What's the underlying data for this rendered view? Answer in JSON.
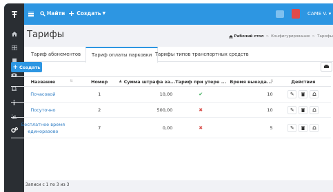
{
  "topbar": {
    "search_label": "Найти",
    "create_label": "Создать",
    "user_label": "CAME V."
  },
  "page": {
    "title": "Тарифы"
  },
  "breadcrumbs": {
    "home": "Рабочий стол",
    "item2": "Конфигурирование",
    "item3": "Тарифы"
  },
  "tabs": [
    {
      "label": "Тариф абонементов"
    },
    {
      "label": "Тариф оплаты парковки"
    },
    {
      "label": "Тарифы типов транспортных средств"
    }
  ],
  "toolbar": {
    "create_label": "Создать"
  },
  "table": {
    "headers": [
      "Название",
      "Номер",
      "Сумма штрафа за...",
      "Тариф при утере ...",
      "Время выезда...",
      "Действия"
    ],
    "rows": [
      {
        "name": "Почасовой",
        "number": "1",
        "fine": "10,00",
        "lost": "check",
        "exit": "10"
      },
      {
        "name": "Посуточно",
        "number": "2",
        "fine": "500,00",
        "lost": "cross",
        "exit": "10"
      },
      {
        "name": "Бесплатное время единоразово",
        "number": "7",
        "fine": "0,00",
        "lost": "cross",
        "exit": "5"
      }
    ]
  },
  "footer": {
    "records_text": "Записи с 1 по 3 из 3"
  },
  "colors": {
    "accent": "#2d96e2",
    "sidebar": "#2a2e33",
    "check": "#2fa84f",
    "cross": "#d9534f"
  }
}
